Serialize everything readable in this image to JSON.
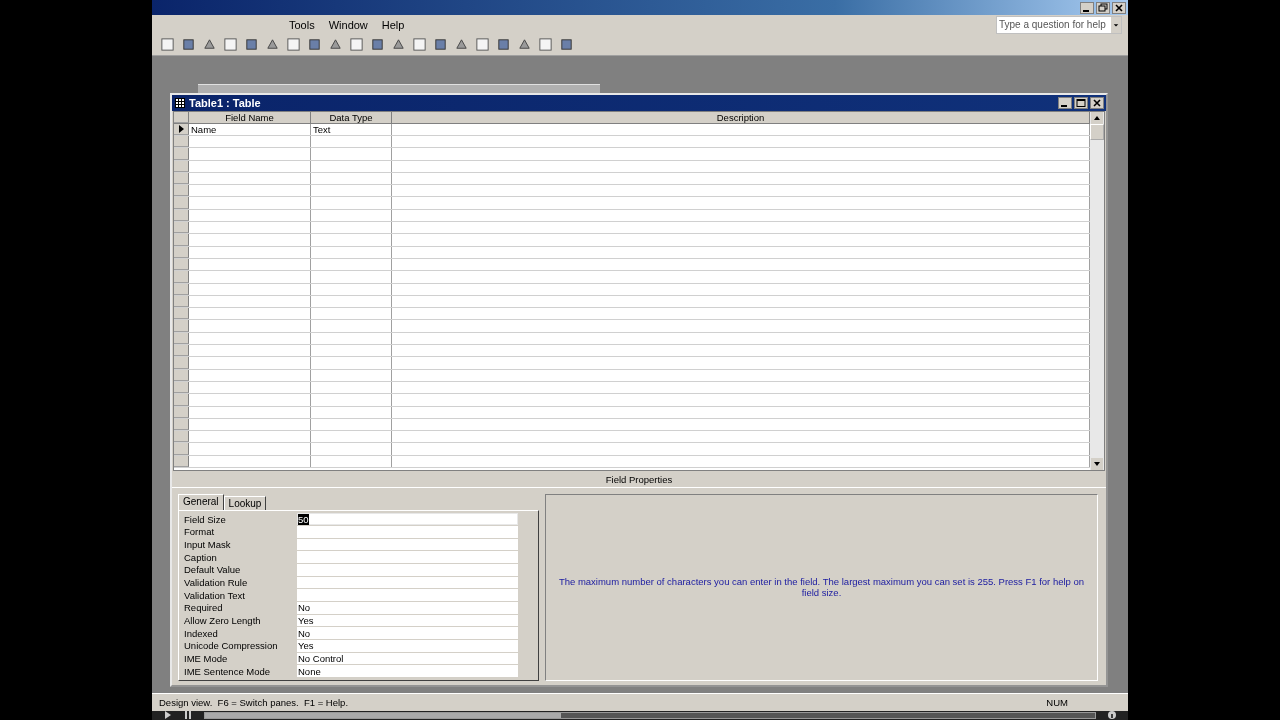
{
  "app": {
    "menu": [
      "Tools",
      "Window",
      "Help"
    ],
    "help_box": {
      "placeholder": "Type a question for help"
    }
  },
  "window": {
    "title": "Table1 : Table"
  },
  "grid": {
    "columns": [
      "Field Name",
      "Data Type",
      "Description"
    ],
    "rows": [
      {
        "field_name": "Name",
        "data_type": "Text",
        "selected": true
      }
    ]
  },
  "field_properties": {
    "title": "Field Properties",
    "tabs": [
      {
        "label": "General",
        "selected": true
      },
      {
        "label": "Lookup",
        "selected": false
      }
    ],
    "properties": [
      {
        "label": "Field Size",
        "value": "50",
        "selected": true
      },
      {
        "label": "Format",
        "selected": false
      },
      {
        "label": "Input Mask",
        "selected": false
      },
      {
        "label": "Caption",
        "selected": false
      },
      {
        "label": "Default Value",
        "selected": false
      },
      {
        "label": "Validation Rule",
        "selected": false
      },
      {
        "label": "Validation Text",
        "selected": false
      },
      {
        "label": "Required",
        "value": "No",
        "selected": false
      },
      {
        "label": "Allow Zero Length",
        "value": "Yes",
        "selected": false
      },
      {
        "label": "Indexed",
        "value": "No",
        "selected": false
      },
      {
        "label": "Unicode Compression",
        "value": "Yes",
        "selected": false
      },
      {
        "label": "IME Mode",
        "value": "No Control",
        "selected": false
      },
      {
        "label": "IME Sentence Mode",
        "value": "None",
        "selected": false
      }
    ],
    "help_text": "The maximum number of characters you can enter in the field.  The largest maximum you can set is 255.  Press F1 for help on field size."
  },
  "status_bar": {
    "text": "Design view.  F6 = Switch panes.  F1 = Help.",
    "indicator": "NUM"
  },
  "player": {
    "level": 0.4
  }
}
